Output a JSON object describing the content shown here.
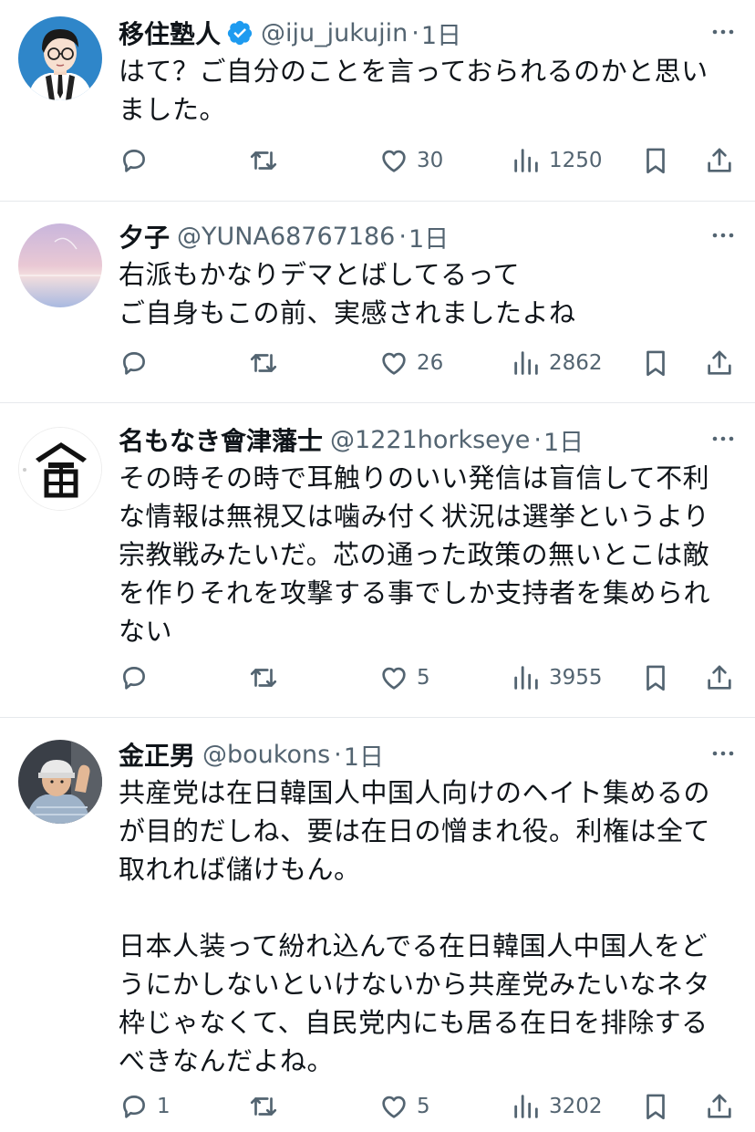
{
  "tweets": [
    {
      "name": "移住塾人",
      "verified": true,
      "handle": "@iju_jukujin",
      "time": "1日",
      "text": "はて？ご自分のことを言っておられるのかと思い\nました。",
      "replies": "",
      "likes": "30",
      "views": "1250"
    },
    {
      "name": "夕子",
      "verified": false,
      "handle": "@YUNA68767186",
      "time": "1日",
      "text": "右派もかなりデマとばしてるって\nご自身もこの前、実感されましたよね",
      "replies": "",
      "likes": "26",
      "views": "2862"
    },
    {
      "name": "名もなき會津藩士",
      "verified": false,
      "handle": "@1221horkseye",
      "time": "1日",
      "text": "その時その時で耳触りのいい発信は盲信して不利\nな情報は無視又は噛み付く状況は選挙というより\n宗教戦みたいだ。芯の通った政策の無いとこは敵\nを作りそれを攻撃する事でしか支持者を集められ\nない",
      "replies": "",
      "likes": "5",
      "views": "3955"
    },
    {
      "name": "金正男",
      "verified": false,
      "handle": "@boukons",
      "time": "1日",
      "text": "共産党は在日韓国人中国人向けのヘイト集めるの\nが目的だしね、要は在日の憎まれ役。利権は全て\n取れれば儲けもん。\n\n日本人装って紛れ込んでる在日韓国人中国人をど\nうにかしないといけないから共産党みたいなネタ\n枠じゃなくて、自民党内にも居る在日を排除する\nべきなんだよね。",
      "replies": "1",
      "likes": "5",
      "views": "3202"
    }
  ],
  "separator": "·",
  "colors": {
    "text": "#0f1419",
    "secondary": "#536471",
    "verified": "#1d9bf0",
    "border": "#e6e9ec"
  },
  "icons": [
    "verified-badge-icon",
    "more-icon",
    "reply-icon",
    "retweet-icon",
    "like-icon",
    "views-icon",
    "bookmark-icon",
    "share-icon"
  ]
}
